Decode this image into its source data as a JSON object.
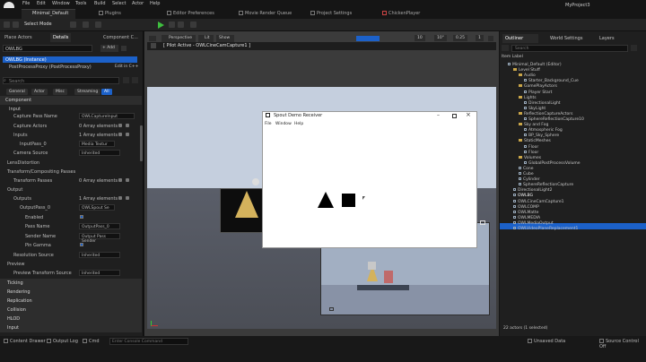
{
  "menu": [
    "File",
    "Edit",
    "Window",
    "Tools",
    "Build",
    "Select",
    "Actor",
    "Help"
  ],
  "map_tab": "Minimal_Default",
  "window_tabs": [
    "Plugins",
    "Editor Preferences",
    "Movie Render Queue",
    "Project Settings",
    "ChickenPlayer"
  ],
  "project_name": "MyProject3",
  "toolbar": {
    "select_mode": "Select Mode"
  },
  "left_tabs": [
    "Place Actors",
    "Details",
    "Component C..."
  ],
  "details": {
    "actor_name": "OWLBG",
    "instance": "OWLBG (Instance)",
    "component": "PostProcessProxy (PostProcessProxy)",
    "edit_cpp": "Edit in C++",
    "search_placeholder": "Search",
    "add_label": "+ Add",
    "categories": [
      "General",
      "Actor",
      "Misc",
      "Streaming",
      "All"
    ],
    "component_header": "Component",
    "input_header": "Input",
    "capture_pass_name_label": "Capture Pass Name",
    "capture_pass_name_value": "OWLCaptureInput",
    "capture_actors_label": "Capture Actors",
    "capture_actors_value": "0 Array elements",
    "inputs_label": "Inputs",
    "inputs_value": "1 Array elements",
    "input_pass_label": "InputPass_0",
    "input_pass_value": "Media Textur",
    "camera_source_label": "Camera Source",
    "camera_source_value": "Inherited",
    "lens_distortion": "LensDistortion",
    "transform_section": "Transform/Compositing Passes",
    "transform_passes_label": "Transform Passes",
    "transform_passes_value": "0 Array elements",
    "output_header": "Output",
    "outputs_label": "Outputs",
    "outputs_value": "1 Array elements",
    "output_pass_label": "OutputPass_0",
    "output_pass_value": "OWLSpout Se",
    "enabled_label": "Enabled",
    "pass_name_label": "Pass Name",
    "pass_name_value": "OutputPass_0",
    "sender_name_label": "Sender Name",
    "sender_name_value": "Output Pass Sender",
    "pin_gamma_label": "Pin Gamma",
    "resolution_source_label": "Resolution Source",
    "resolution_source_value": "Inherited",
    "preview_header": "Preview",
    "preview_transform_label": "Preview Transform Source",
    "preview_transform_value": "Inherited",
    "collapsed_sections": [
      "Ticking",
      "Rendering",
      "Replication",
      "Collision",
      "HLOD",
      "Input"
    ]
  },
  "viewport": {
    "perspective": "Perspective",
    "lit": "Lit",
    "show": "Show",
    "pilot_label": "[ Pilot Active - OWLCineCamCapture1 ]",
    "grid_snap": "10",
    "rot_snap": "10°",
    "scale_snap": "0.25",
    "cam_speed": "1"
  },
  "dialog": {
    "title": "Spout Demo Receiver",
    "menu": [
      "File",
      "Window",
      "Help"
    ]
  },
  "outliner": {
    "title": "Outliner",
    "tabs": [
      "World Settings",
      "Layers"
    ],
    "search_placeholder": "Search",
    "column_label": "Item Label",
    "items": [
      {
        "label": "Minimal_Default (Editor)",
        "indent": 1,
        "kind": "world"
      },
      {
        "label": "Level Stuff",
        "indent": 2,
        "kind": "folder"
      },
      {
        "label": "Audio",
        "indent": 3,
        "kind": "folder"
      },
      {
        "label": "Starter_Background_Cue",
        "indent": 4,
        "kind": "actor"
      },
      {
        "label": "GamePlayActors",
        "indent": 3,
        "kind": "folder"
      },
      {
        "label": "Player Start",
        "indent": 4,
        "kind": "actor"
      },
      {
        "label": "Lights",
        "indent": 3,
        "kind": "folder"
      },
      {
        "label": "DirectionalLight",
        "indent": 4,
        "kind": "actor"
      },
      {
        "label": "SkyLight",
        "indent": 4,
        "kind": "actor"
      },
      {
        "label": "ReflectionCaptureActors",
        "indent": 3,
        "kind": "folder"
      },
      {
        "label": "SphereReflectionCapture10",
        "indent": 4,
        "kind": "actor"
      },
      {
        "label": "Sky and Fog",
        "indent": 3,
        "kind": "folder"
      },
      {
        "label": "Atmospheric Fog",
        "indent": 4,
        "kind": "actor"
      },
      {
        "label": "BP_Sky_Sphere",
        "indent": 4,
        "kind": "actor"
      },
      {
        "label": "StaticMeshes",
        "indent": 3,
        "kind": "folder"
      },
      {
        "label": "Floor",
        "indent": 4,
        "kind": "actor"
      },
      {
        "label": "Floor",
        "indent": 4,
        "kind": "actor"
      },
      {
        "label": "Volumes",
        "indent": 3,
        "kind": "folder"
      },
      {
        "label": "GlobalPostProcessVolume",
        "indent": 4,
        "kind": "actor"
      },
      {
        "label": "Cone",
        "indent": 3,
        "kind": "actor"
      },
      {
        "label": "Cube",
        "indent": 3,
        "kind": "actor"
      },
      {
        "label": "Cylinder",
        "indent": 3,
        "kind": "actor"
      },
      {
        "label": "SphereReflectionCapture",
        "indent": 3,
        "kind": "actor"
      },
      {
        "label": "DirectionalLight2",
        "indent": 2,
        "kind": "actor"
      },
      {
        "label": "OWLBG",
        "indent": 2,
        "kind": "actor",
        "selected": true
      },
      {
        "label": "OWLCineCamCapture1",
        "indent": 2,
        "kind": "actor"
      },
      {
        "label": "OWLCOMP",
        "indent": 2,
        "kind": "actor"
      },
      {
        "label": "OWLMatte",
        "indent": 2,
        "kind": "actor"
      },
      {
        "label": "OWLMEDIA",
        "indent": 2,
        "kind": "actor"
      },
      {
        "label": "OWLMediaOutput",
        "indent": 2,
        "kind": "actor"
      },
      {
        "label": "OWLVideoPlaneReplacement1",
        "indent": 2,
        "kind": "actor"
      }
    ],
    "status": "22 actors (1 selected)"
  },
  "bottom": {
    "content_drawer": "Content Drawer",
    "output_log": "Output Log",
    "cmd": "Cmd",
    "console_placeholder": "Enter Console Command",
    "unsaved": "Unsaved Data",
    "source_control": "Source Control Off"
  },
  "colors": {
    "accent": "#1c61c9",
    "play": "#3fbf3f",
    "folder": "#c9a548"
  }
}
